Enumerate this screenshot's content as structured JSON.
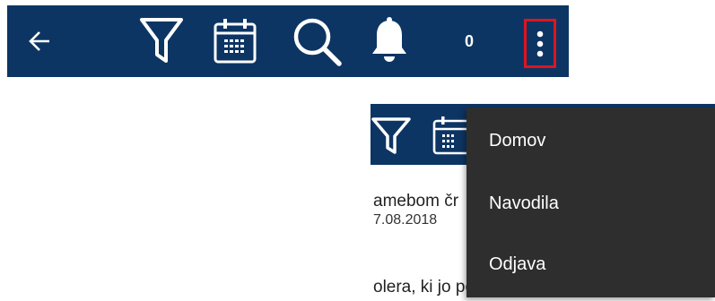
{
  "toolbar": {
    "icons": [
      "back-arrow-icon",
      "filter-icon",
      "calendar-icon",
      "search-icon",
      "bell-icon",
      "more-vert-icon"
    ],
    "notification_count": "0",
    "highlight_color": "#e0141e",
    "background_color": "#0d3563"
  },
  "preview": {
    "line1": "amebom čr",
    "date": "7.08.2018",
    "line2": "olera, ki jo povzroča vibrio cholerae"
  },
  "menu": {
    "items": [
      "Domov",
      "Navodila",
      "Odjava"
    ],
    "background_color": "#2e2e2e"
  }
}
